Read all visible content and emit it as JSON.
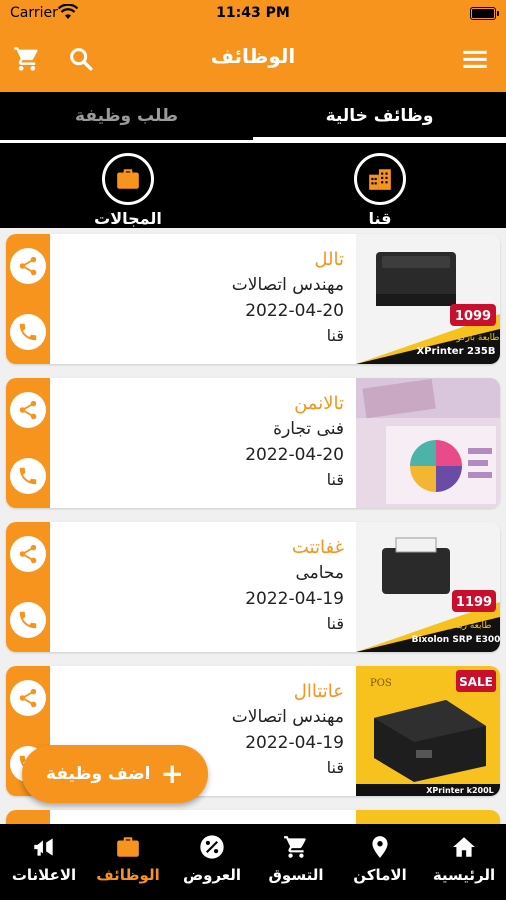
{
  "status": {
    "carrier": "Carrier",
    "time": "11:43 PM"
  },
  "header": {
    "title": "الوظائف"
  },
  "tabs": [
    {
      "label": "وظائف خالية",
      "active": true
    },
    {
      "label": "طلب وظيفة",
      "active": false
    }
  ],
  "filters": [
    {
      "label": "قنا",
      "icon": "buildings-icon"
    },
    {
      "label": "المجالات",
      "icon": "briefcase-icon"
    }
  ],
  "jobs": [
    {
      "title": "تالل",
      "field": "مهندس اتصالات",
      "date": "2022-04-20",
      "place": "قنا",
      "thumb_price": "1099",
      "thumb_caption": "XPrinter 235B",
      "thumb_label": "طابعة باركود"
    },
    {
      "title": "تالانمن",
      "field": "فنى تجارة",
      "date": "2022-04-20",
      "place": "قنا"
    },
    {
      "title": "غفاتتت",
      "field": "محامى",
      "date": "2022-04-19",
      "place": "قنا",
      "thumb_price": "1199",
      "thumb_caption": "Bixolon SRP E300",
      "thumb_label": "طابعة ريسيت"
    },
    {
      "title": "عاتتاال",
      "field": "مهندس اتصالات",
      "date": "2022-04-19",
      "place": "قنا",
      "thumb_caption": "XPrinter k200L",
      "thumb_badge": "SALE",
      "thumb_brand": "POS"
    }
  ],
  "fab": {
    "label": "اضف وظيفة"
  },
  "nav": [
    {
      "label": "الرئيسية",
      "icon": "home-icon",
      "active": false
    },
    {
      "label": "الاماكن",
      "icon": "location-pin-icon",
      "active": false
    },
    {
      "label": "التسوق",
      "icon": "cart-icon",
      "active": false
    },
    {
      "label": "العروض",
      "icon": "percent-badge-icon",
      "active": false
    },
    {
      "label": "الوظائف",
      "icon": "briefcase-icon",
      "active": true
    },
    {
      "label": "الاعلانات",
      "icon": "megaphone-icon",
      "active": false
    }
  ],
  "colors": {
    "accent": "#f7941d",
    "dark": "#000000",
    "card": "#ffffff"
  }
}
